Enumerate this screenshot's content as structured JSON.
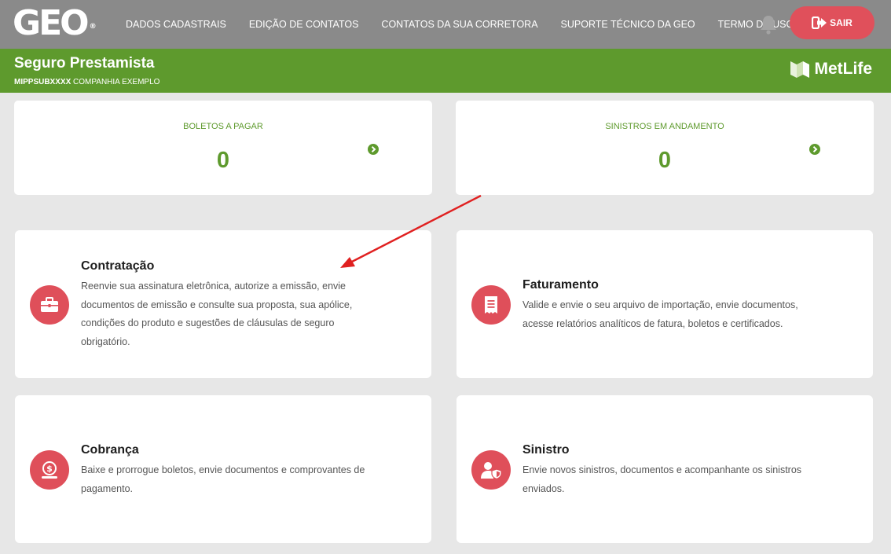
{
  "header": {
    "logo_text": "GEO",
    "logo_mark": "®",
    "nav": [
      "DADOS CADASTRAIS",
      "EDIÇÃO DE CONTATOS",
      "CONTATOS DA SUA CORRETORA",
      "SUPORTE TÉCNICO DA GEO",
      "TERMO DE USO"
    ],
    "bell_icon": "bell-icon",
    "logout_label": "SAIR",
    "logout_icon": "sign-out-icon"
  },
  "product": {
    "title": "Seguro Prestamista",
    "code": "MIPPSUBXXXX",
    "company": "COMPANHIA EXEMPLO",
    "insurer": "MetLife"
  },
  "stats": [
    {
      "label": "BOLETOS A PAGAR",
      "value": "0",
      "icon": "chevron-right-circle-icon"
    },
    {
      "label": "SINISTROS EM ANDAMENTO",
      "value": "0",
      "icon": "chevron-right-circle-icon"
    }
  ],
  "cards": [
    {
      "title": "Contratação",
      "icon": "briefcase-icon",
      "lines": [
        "Reenvie sua assinatura eletrônica, autorize a emissão, envie",
        "documentos de emissão e consulte sua proposta, sua apólice,",
        "condições do produto e sugestões de cláusulas de seguro",
        "obrigatório."
      ]
    },
    {
      "title": "Faturamento",
      "icon": "receipt-icon",
      "lines": [
        "Valide e envie o seu arquivo de importação, envie documentos,",
        "acesse relatórios analíticos de fatura, boletos e certificados."
      ]
    },
    {
      "title": "Cobrança",
      "icon": "dollar-coin-icon",
      "lines": [
        "Baixe e prorrogue boletos, envie documentos e comprovantes de",
        "pagamento."
      ]
    },
    {
      "title": "Sinistro",
      "icon": "user-shield-icon",
      "lines": [
        "Envie novos sinistros, documentos e acompanhante os sinistros",
        "enviados."
      ]
    }
  ],
  "colors": {
    "topbar": "#8a8a8a",
    "brand_green": "#5e9a2d",
    "accent_red": "#df4f5a",
    "annotation_arrow": "#e02020"
  }
}
